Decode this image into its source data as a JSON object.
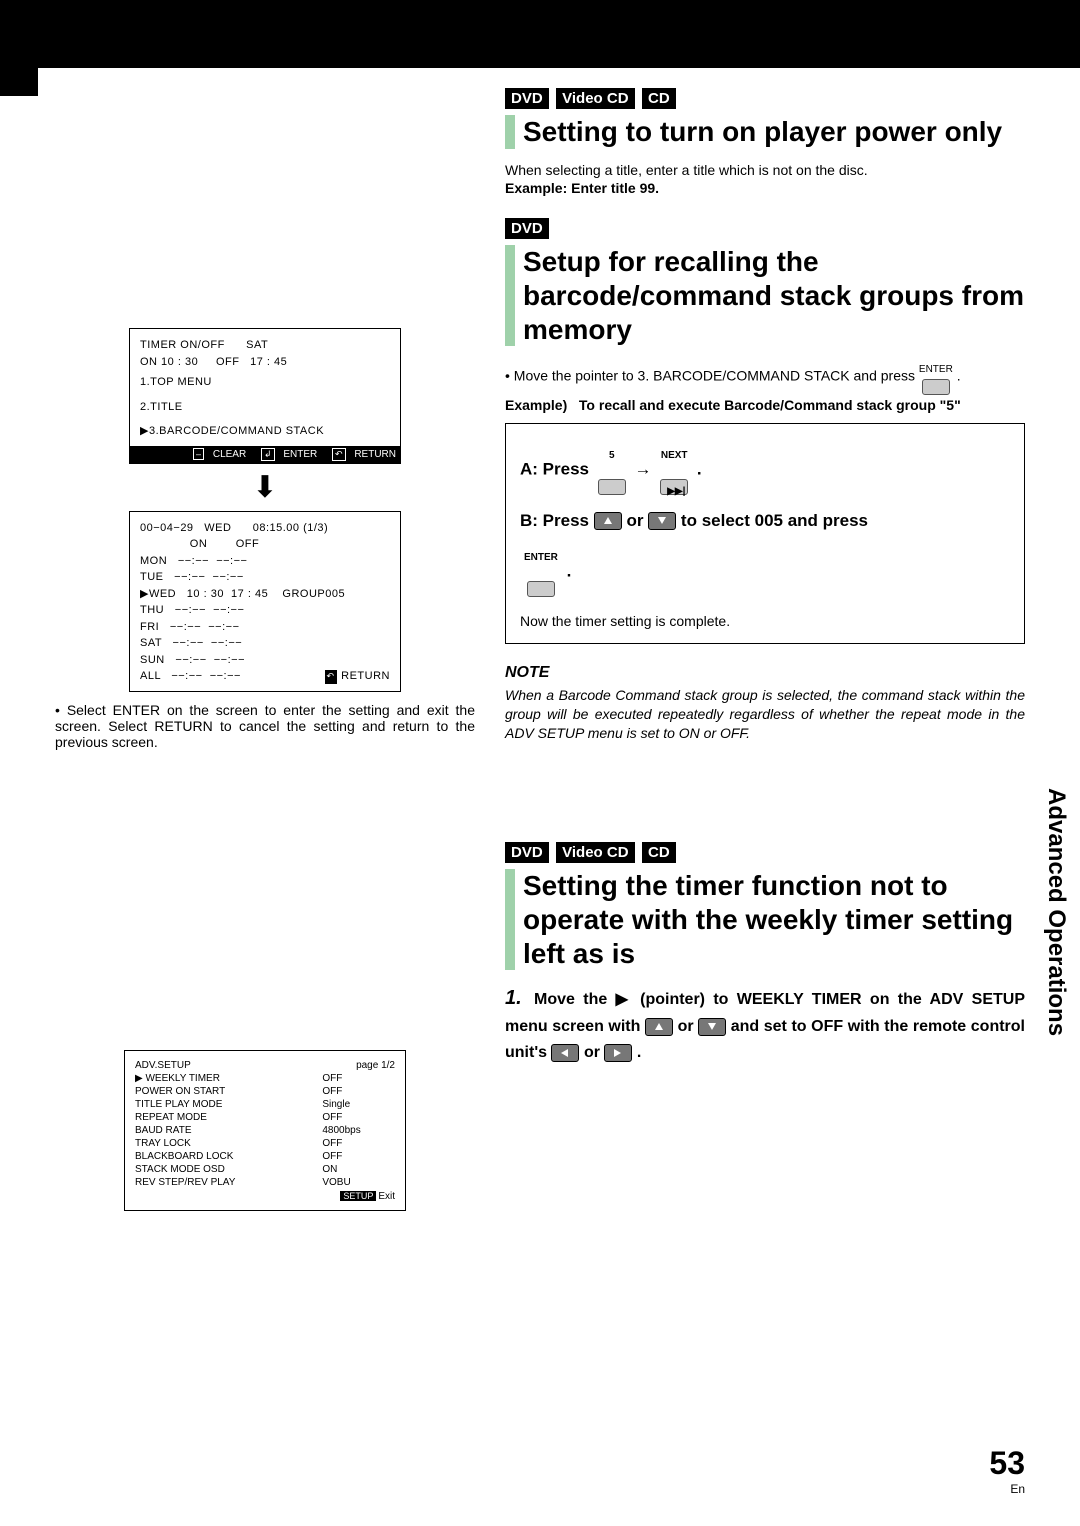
{
  "page_number": "53",
  "locale": "En",
  "sidetab": "Advanced Operations",
  "left": {
    "timer_screen": {
      "line1": "TIMER ON/OFF      SAT",
      "line2": "ON 10 : 30     OFF   17 : 45",
      "menu1": "1.TOP MENU",
      "menu2": "2.TITLE",
      "menu3": "▶3.BARCODE/COMMAND STACK",
      "footer_clear": "CLEAR",
      "footer_enter": "ENTER",
      "footer_return": "RETURN"
    },
    "weekly_screen": {
      "header": "00−04−29   WED      08:15.00 (1/3)",
      "onoff": "              ON        OFF",
      "rows": [
        "MON   −−:−−  −−:−−",
        "TUE   −−:−−  −−:−−",
        "▶WED   10 : 30  17 : 45    GROUP005",
        "THU   −−:−−  −−:−−",
        "FRI   −−:−−  −−:−−",
        "SAT   −−:−−  −−:−−",
        "SUN   −−:−−  −−:−−",
        "ALL   −−:−−  −−:−−"
      ],
      "footer_return": "RETURN"
    },
    "footnote": "Select ENTER on the screen to enter the setting and exit the screen. Select RETURN to cancel the setting and return to the previous screen.",
    "adv_setup": {
      "title": "ADV.SETUP",
      "page": "page 1/2",
      "rows": [
        [
          "▶  WEEKLY TIMER",
          "OFF"
        ],
        [
          "POWER ON START",
          "OFF"
        ],
        [
          "TITLE PLAY MODE",
          "Single"
        ],
        [
          "REPEAT MODE",
          "OFF"
        ],
        [
          "BAUD RATE",
          "4800bps"
        ],
        [
          "TRAY LOCK",
          "OFF"
        ],
        [
          "BLACKBOARD LOCK",
          "OFF"
        ],
        [
          "STACK MODE OSD",
          "ON"
        ],
        [
          "REV STEP/REV PLAY",
          "VOBU"
        ]
      ],
      "exit": "Exit"
    }
  },
  "right": {
    "s1": {
      "badges": [
        "DVD",
        "Video CD",
        "CD"
      ],
      "title": "Setting to turn on player power only",
      "body": "When selecting a title, enter a title which is not on the disc.",
      "example": "Example: Enter title 99."
    },
    "s2": {
      "badge": "DVD",
      "title": "Setup for recalling the barcode/command stack groups from memory",
      "intro": "Move the pointer to 3. BARCODE/COMMAND STACK and press",
      "enter": "ENTER",
      "example_label": "Example)",
      "example_text": "To recall and execute Barcode/Command stack group \"5\"",
      "boxA_prefix": "A: Press",
      "boxA_5": "5",
      "boxA_arrow": "→",
      "boxA_next": "NEXT",
      "boxB_prefix": "B: Press",
      "boxB_or": "or",
      "boxB_rest": "to select 005 and press",
      "boxB_enter": "ENTER",
      "complete": "Now the timer setting is complete.",
      "note_hdr": "NOTE",
      "note_body": "When a Barcode Command stack group is selected, the command stack within the group will be executed repeatedly regardless of whether the repeat mode in the ADV SETUP menu is set to ON or OFF."
    },
    "s3": {
      "badges": [
        "DVD",
        "Video CD",
        "CD"
      ],
      "title": "Setting the timer function not to operate with the weekly timer setting left as is",
      "step_prefix": "Move the ▶ (pointer) to WEEKLY TIMER on the ADV SETUP menu screen with",
      "step_or1": "or",
      "step_mid": "and set to OFF with the remote control unit's",
      "step_or2": "or",
      "step_end": "."
    }
  }
}
